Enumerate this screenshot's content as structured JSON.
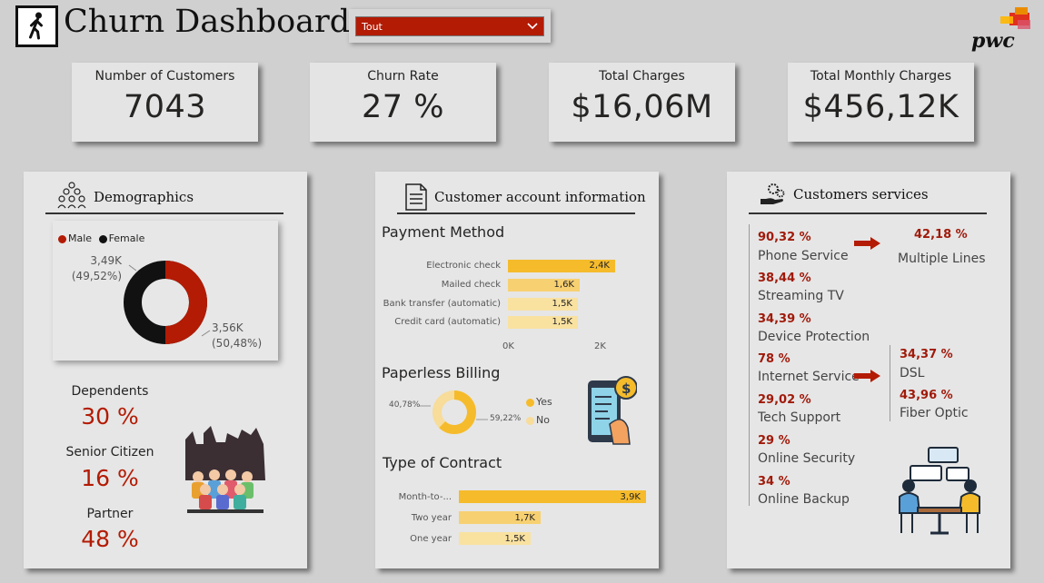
{
  "header": {
    "title": "Churn Dashboard",
    "slicer_value": "Tout"
  },
  "kpis": [
    {
      "label": "Number of Customers",
      "value": "7043"
    },
    {
      "label": "Churn Rate",
      "value": "27 %"
    },
    {
      "label": "Total Charges",
      "value": "$16,06M"
    },
    {
      "label": "Total Monthly Charges",
      "value": "$456,12K"
    }
  ],
  "demographics": {
    "title": "Demographics",
    "legend": [
      {
        "label": "Male",
        "color": "#b31b04"
      },
      {
        "label": "Female",
        "color": "#111111"
      }
    ],
    "female_label": "3,49K",
    "female_pct": "(49,52%)",
    "male_label": "3,56K",
    "male_pct": "(50,48%)",
    "dependents_label": "Dependents",
    "dependents_value": "30 %",
    "senior_label": "Senior Citizen",
    "senior_value": "16 %",
    "partner_label": "Partner",
    "partner_value": "48 %"
  },
  "account": {
    "title": "Customer account information",
    "payment_title": "Payment Method",
    "payment": [
      {
        "label": "Electronic check",
        "value": "2,4K",
        "n": 2.4
      },
      {
        "label": "Mailed check",
        "value": "1,6K",
        "n": 1.6
      },
      {
        "label": "Bank transfer (automatic)",
        "value": "1,5K",
        "n": 1.5
      },
      {
        "label": "Credit card (automatic)",
        "value": "1,5K",
        "n": 1.5
      }
    ],
    "axis": [
      "0K",
      "2K"
    ],
    "paperless_title": "Paperless Billing",
    "paperless_yes_pct": "59,22%",
    "paperless_no_pct": "40,78%",
    "paperless_legend_yes": "Yes",
    "paperless_legend_no": "No",
    "contract_title": "Type of Contract",
    "contract": [
      {
        "label": "Month-to-...",
        "value": "3,9K",
        "n": 3.9
      },
      {
        "label": "Two year",
        "value": "1,7K",
        "n": 1.7
      },
      {
        "label": "One year",
        "value": "1,5K",
        "n": 1.5
      }
    ]
  },
  "services": {
    "title": "Customers services",
    "phone_pct": "90,32 %",
    "phone": "Phone Service",
    "multi_pct": "42,18 %",
    "multi": "Multiple Lines",
    "stream_pct": "38,44 %",
    "stream": "Streaming TV",
    "device_pct": "34,39 %",
    "device": "Device Protection",
    "internet_pct": "78 %",
    "internet": "Internet Service",
    "dsl_pct": "34,37 %",
    "dsl": "DSL",
    "fiber_pct": "43,96 %",
    "fiber": "Fiber Optic",
    "tech_pct": "29,02 %",
    "tech": "Tech Support",
    "security_pct": "29 %",
    "security": "Online Security",
    "backup_pct": "34 %",
    "backup": "Online Backup"
  },
  "chart_data": [
    {
      "type": "pie",
      "title": "",
      "categories": [
        "Male",
        "Female"
      ],
      "values": [
        3560,
        3490
      ],
      "percent": [
        50.48,
        49.52
      ]
    },
    {
      "type": "bar",
      "title": "Payment Method",
      "categories": [
        "Electronic check",
        "Mailed check",
        "Bank transfer (automatic)",
        "Credit card (automatic)"
      ],
      "values": [
        2400,
        1600,
        1500,
        1500
      ],
      "xlim": [
        0,
        2500
      ]
    },
    {
      "type": "pie",
      "title": "Paperless Billing",
      "categories": [
        "Yes",
        "No"
      ],
      "percent": [
        59.22,
        40.78
      ]
    },
    {
      "type": "bar",
      "title": "Type of Contract",
      "categories": [
        "Month-to-...",
        "Two year",
        "One year"
      ],
      "values": [
        3900,
        1700,
        1500
      ]
    }
  ]
}
